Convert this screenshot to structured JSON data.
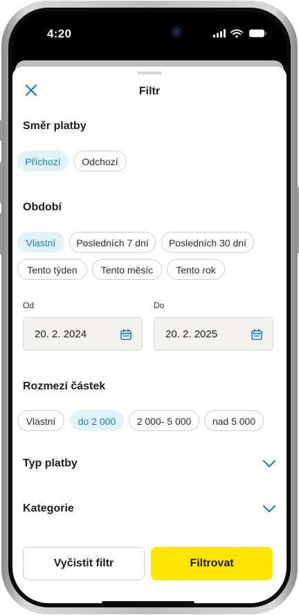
{
  "status_bar": {
    "time": "4:20"
  },
  "header": {
    "title": "Filtr"
  },
  "payment_direction": {
    "title": "Směr platby",
    "chips": [
      {
        "label": "Příchozí",
        "selected": true
      },
      {
        "label": "Odchozí",
        "selected": false
      }
    ]
  },
  "period": {
    "title": "Období",
    "chips": [
      {
        "label": "Vlastní",
        "selected": true
      },
      {
        "label": "Posledních 7 dní",
        "selected": false
      },
      {
        "label": "Posledních 30 dní",
        "selected": false
      },
      {
        "label": "Tento týden",
        "selected": false
      },
      {
        "label": "Tento měsíc",
        "selected": false
      },
      {
        "label": "Tento rok",
        "selected": false
      }
    ],
    "from": {
      "label": "Od",
      "value": "20. 2. 2024"
    },
    "to": {
      "label": "Do",
      "value": "20. 2. 2025"
    }
  },
  "amount_range": {
    "title": "Rozmezí částek",
    "chips": [
      {
        "label": "Vlastní",
        "selected": false
      },
      {
        "label": "do 2 000",
        "selected": true
      },
      {
        "label": "2 000- 5 000",
        "selected": false
      },
      {
        "label": "nad 5 000",
        "selected": false
      }
    ]
  },
  "payment_type": {
    "title": "Typ platby"
  },
  "category": {
    "title": "Kategorie"
  },
  "actions": {
    "clear_label": "Vyčistit filtr",
    "apply_label": "Filtrovat"
  },
  "colors": {
    "accent": "#1b7fb0",
    "selected_chip_bg": "#e2f2f9",
    "primary_button": "#ffe500",
    "date_field_bg": "#f3f2ee"
  }
}
